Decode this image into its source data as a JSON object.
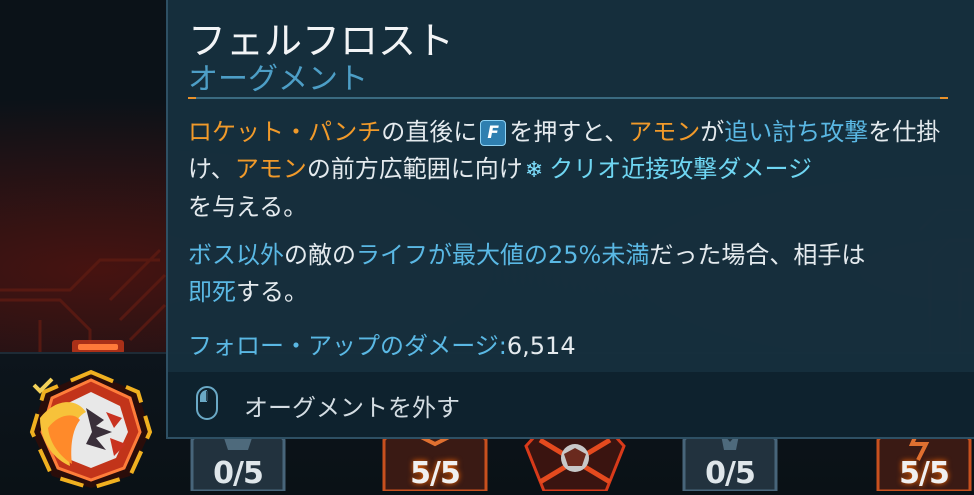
{
  "tooltip": {
    "title": "フェルフロスト",
    "subtitle": "オーグメント",
    "para1": {
      "t1": "ロケット・パンチ",
      "t2": "の直後に",
      "key": "F",
      "t3": "を押すと、",
      "t4": "アモン",
      "t5": "が",
      "t6": "追い討ち攻撃",
      "t7": "を仕掛け、",
      "t8": "アモン",
      "t9": "の前方広範囲に向け",
      "t10": "クリオ近接攻撃ダメージ",
      "t11": "を与える。"
    },
    "para2": {
      "t1": "ボス以外",
      "t2": "の敵の",
      "t3": "ライフが最大値の25%未満",
      "t4": "だった場合、相手は",
      "t5": "即死",
      "t6": "する。"
    },
    "followup_label": "フォロー・アップのダメージ:",
    "followup_value": "6,514",
    "footer_action": "オーグメントを外す"
  },
  "slots": [
    {
      "count": "0/5"
    },
    {
      "count": "5/5"
    },
    {
      "count": "0/5"
    },
    {
      "count": "5/5"
    }
  ],
  "colors": {
    "keyword_orange": "#f19a2a",
    "keyword_blue": "#5ab8e4",
    "cryo": "#6fd6f2",
    "panel": "#16303e"
  },
  "icons": {
    "selected_augment": "flame-claw-icon",
    "equipped_check": "checkmark-icon",
    "footer": "mouse-right-click-icon",
    "damage_type": "snowflake-icon"
  }
}
